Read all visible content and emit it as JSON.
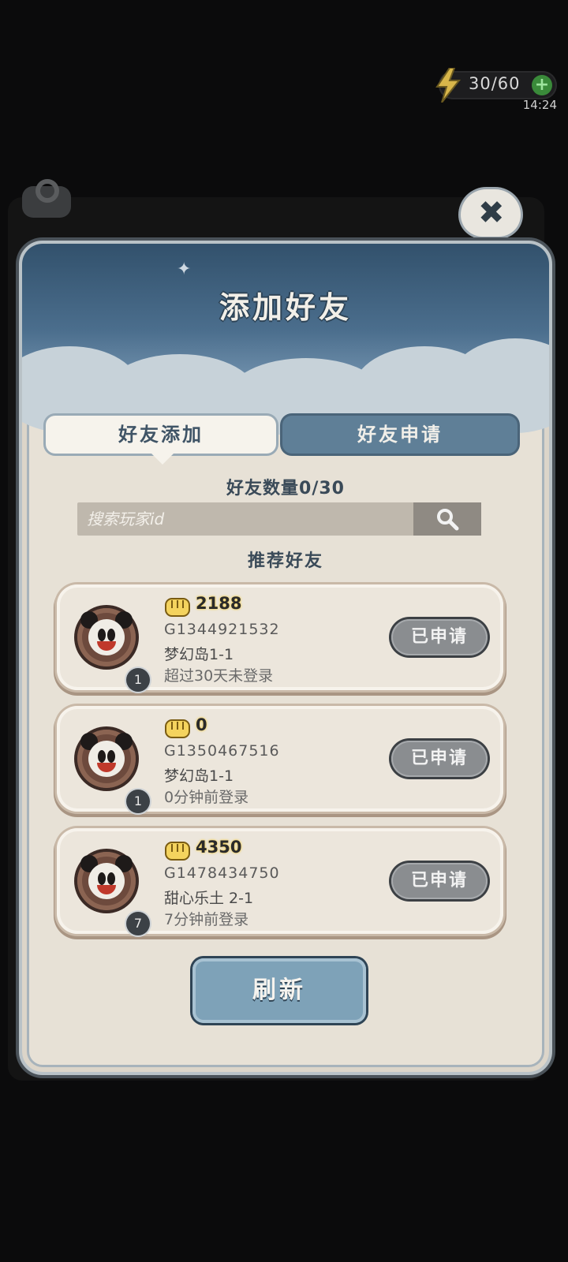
{
  "status": {
    "energy_text": "30/60",
    "energy_plus": "+",
    "clock": "14:24"
  },
  "dialog": {
    "title": "添加好友",
    "close": "✖",
    "tabs": [
      {
        "label": "好友添加",
        "active": true
      },
      {
        "label": "好友申请",
        "active": false
      }
    ],
    "friend_count": "好友数量0/30",
    "search_placeholder": "搜索玩家id",
    "recommend_title": "推荐好友",
    "friends": [
      {
        "power": "2188",
        "id": "G1344921532",
        "stage": "梦幻岛1-1",
        "login": "超过30天未登录",
        "level": "1",
        "button": "已申请"
      },
      {
        "power": "0",
        "id": "G1350467516",
        "stage": "梦幻岛1-1",
        "login": "0分钟前登录",
        "level": "1",
        "button": "已申请"
      },
      {
        "power": "4350",
        "id": "G1478434750",
        "stage": "甜心乐土 2-1",
        "login": "7分钟前登录",
        "level": "7",
        "button": "已申请"
      }
    ],
    "refresh_label": "刷新"
  },
  "colors": {
    "header_blue": "#4b6e8d",
    "panel_paper": "#e7e1d6",
    "active_tab": "#f6f3ec",
    "inactive_tab": "#5f7f97",
    "refresh_button": "#7ea2b8",
    "applied_button": "#8a8d90"
  }
}
